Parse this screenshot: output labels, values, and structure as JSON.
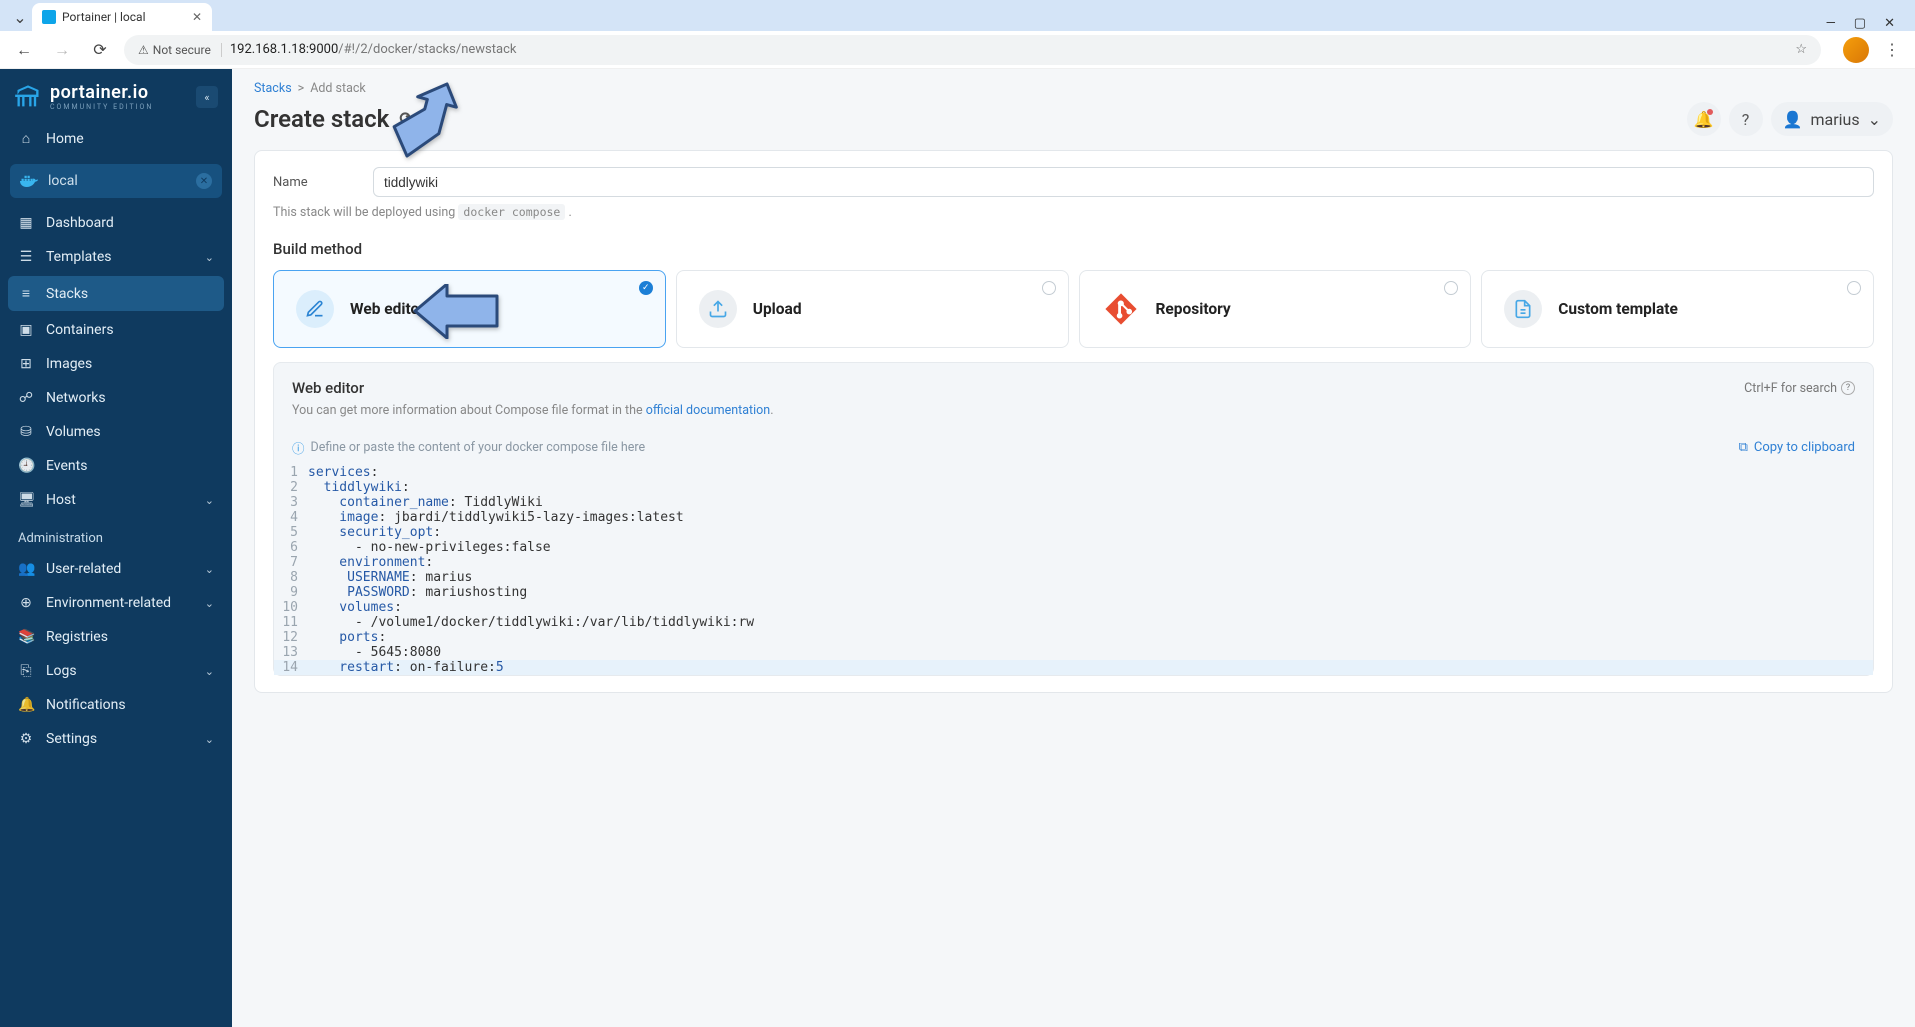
{
  "browser": {
    "tab_title": "Portainer | local",
    "security_label": "Not secure",
    "url_host": "192.168.1.18:9000",
    "url_path": "/#!/2/docker/stacks/newstack"
  },
  "brand": {
    "name": "portainer.io",
    "edition": "COMMUNITY EDITION"
  },
  "user": {
    "name": "marius"
  },
  "nav": {
    "home": "Home",
    "local": "local",
    "items": [
      "Dashboard",
      "Templates",
      "Stacks",
      "Containers",
      "Images",
      "Networks",
      "Volumes",
      "Events",
      "Host"
    ],
    "admin_label": "Administration",
    "admin_items": [
      "User-related",
      "Environment-related",
      "Registries",
      "Logs",
      "Notifications",
      "Settings"
    ]
  },
  "breadcrumb": {
    "root": "Stacks",
    "current": "Add stack"
  },
  "page_title": "Create stack",
  "form": {
    "name_label": "Name",
    "name_value": "tiddlywiki",
    "deploy_hint_pre": "This stack will be deployed using ",
    "deploy_hint_code": "docker compose",
    "build_method_label": "Build method",
    "methods": [
      "Web editor",
      "Upload",
      "Repository",
      "Custom template"
    ]
  },
  "editor": {
    "title": "Web editor",
    "search_hint": "Ctrl+F for search",
    "sub_pre": "You can get more information about Compose file format in the ",
    "sub_link": "official documentation",
    "define_hint": "Define or paste the content of your docker compose file here",
    "copy_label": "Copy to clipboard",
    "code": [
      {
        "n": 1,
        "k": "services",
        "v": ""
      },
      {
        "n": 2,
        "k": "  tiddlywiki",
        "v": ""
      },
      {
        "n": 3,
        "k": "    container_name",
        "v": " TiddlyWiki"
      },
      {
        "n": 4,
        "k": "    image",
        "v": " jbardi/tiddlywiki5-lazy-images:latest"
      },
      {
        "n": 5,
        "k": "    security_opt",
        "v": ""
      },
      {
        "n": 6,
        "raw": "      - no-new-privileges:false"
      },
      {
        "n": 7,
        "k": "    environment",
        "v": ""
      },
      {
        "n": 8,
        "k": "     USERNAME",
        "v": " marius"
      },
      {
        "n": 9,
        "k": "     PASSWORD",
        "v": " mariushosting"
      },
      {
        "n": 10,
        "k": "    volumes",
        "v": ""
      },
      {
        "n": 11,
        "raw": "      - /volume1/docker/tiddlywiki:/var/lib/tiddlywiki:rw"
      },
      {
        "n": 12,
        "k": "    ports",
        "v": ""
      },
      {
        "n": 13,
        "raw": "      - 5645:8080"
      },
      {
        "n": 14,
        "k": "    restart",
        "v": " on-failure:",
        "num": "5"
      }
    ]
  }
}
